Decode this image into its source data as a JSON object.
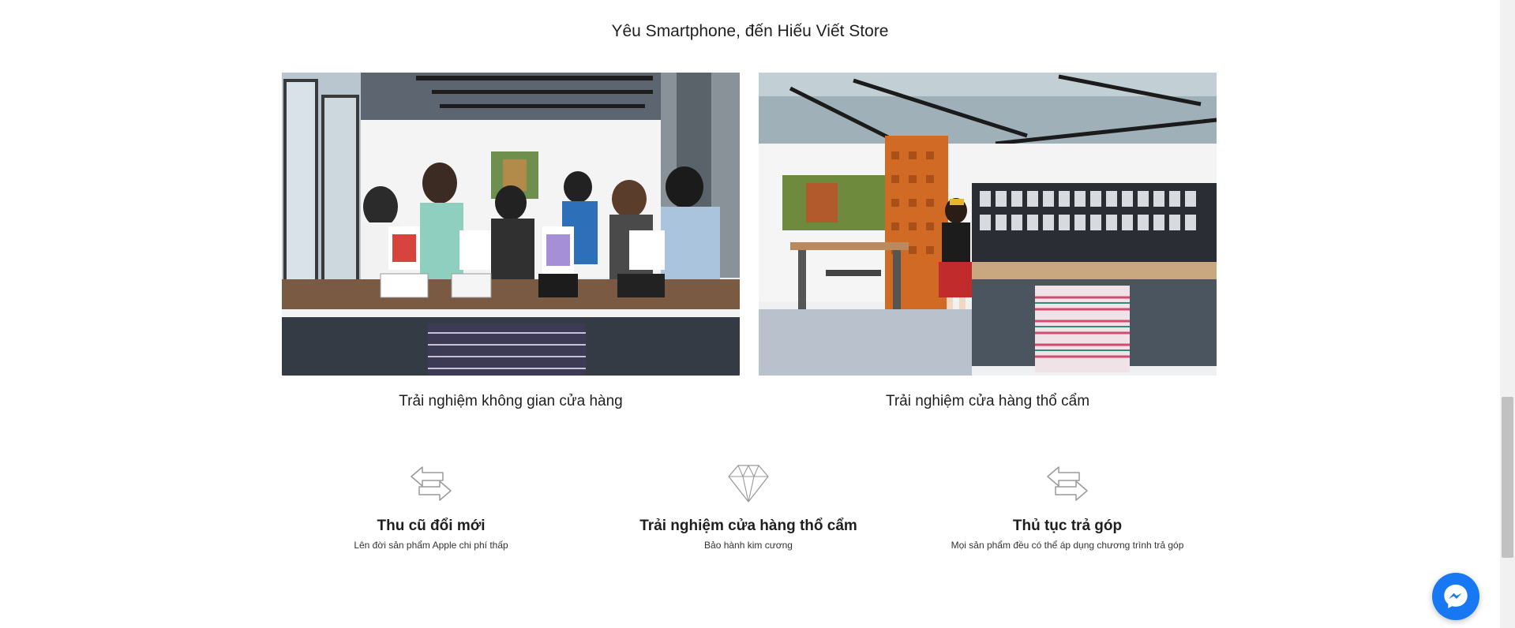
{
  "section": {
    "heading": "Yêu Smartphone, đến Hiếu Viết Store"
  },
  "gallery": [
    {
      "caption": "Trải nghiệm không gian cửa hàng"
    },
    {
      "caption": "Trải nghiệm cửa hàng thổ cẩm"
    }
  ],
  "features": [
    {
      "icon": "swap-arrows-icon",
      "title": "Thu cũ đổi mới",
      "description": "Lên đời sản phẩm Apple chi phí thấp"
    },
    {
      "icon": "diamond-icon",
      "title": "Trải nghiệm cửa hàng thổ cẩm",
      "description": "Bảo hành kim cương"
    },
    {
      "icon": "swap-arrows-icon",
      "title": "Thủ tục trả góp",
      "description": "Mọi sản phẩm đều có thể áp dụng chương trình trả góp"
    }
  ],
  "colors": {
    "messenger": "#1877f2",
    "text": "#1f1f1f",
    "icon_stroke": "#9a9a9a"
  }
}
